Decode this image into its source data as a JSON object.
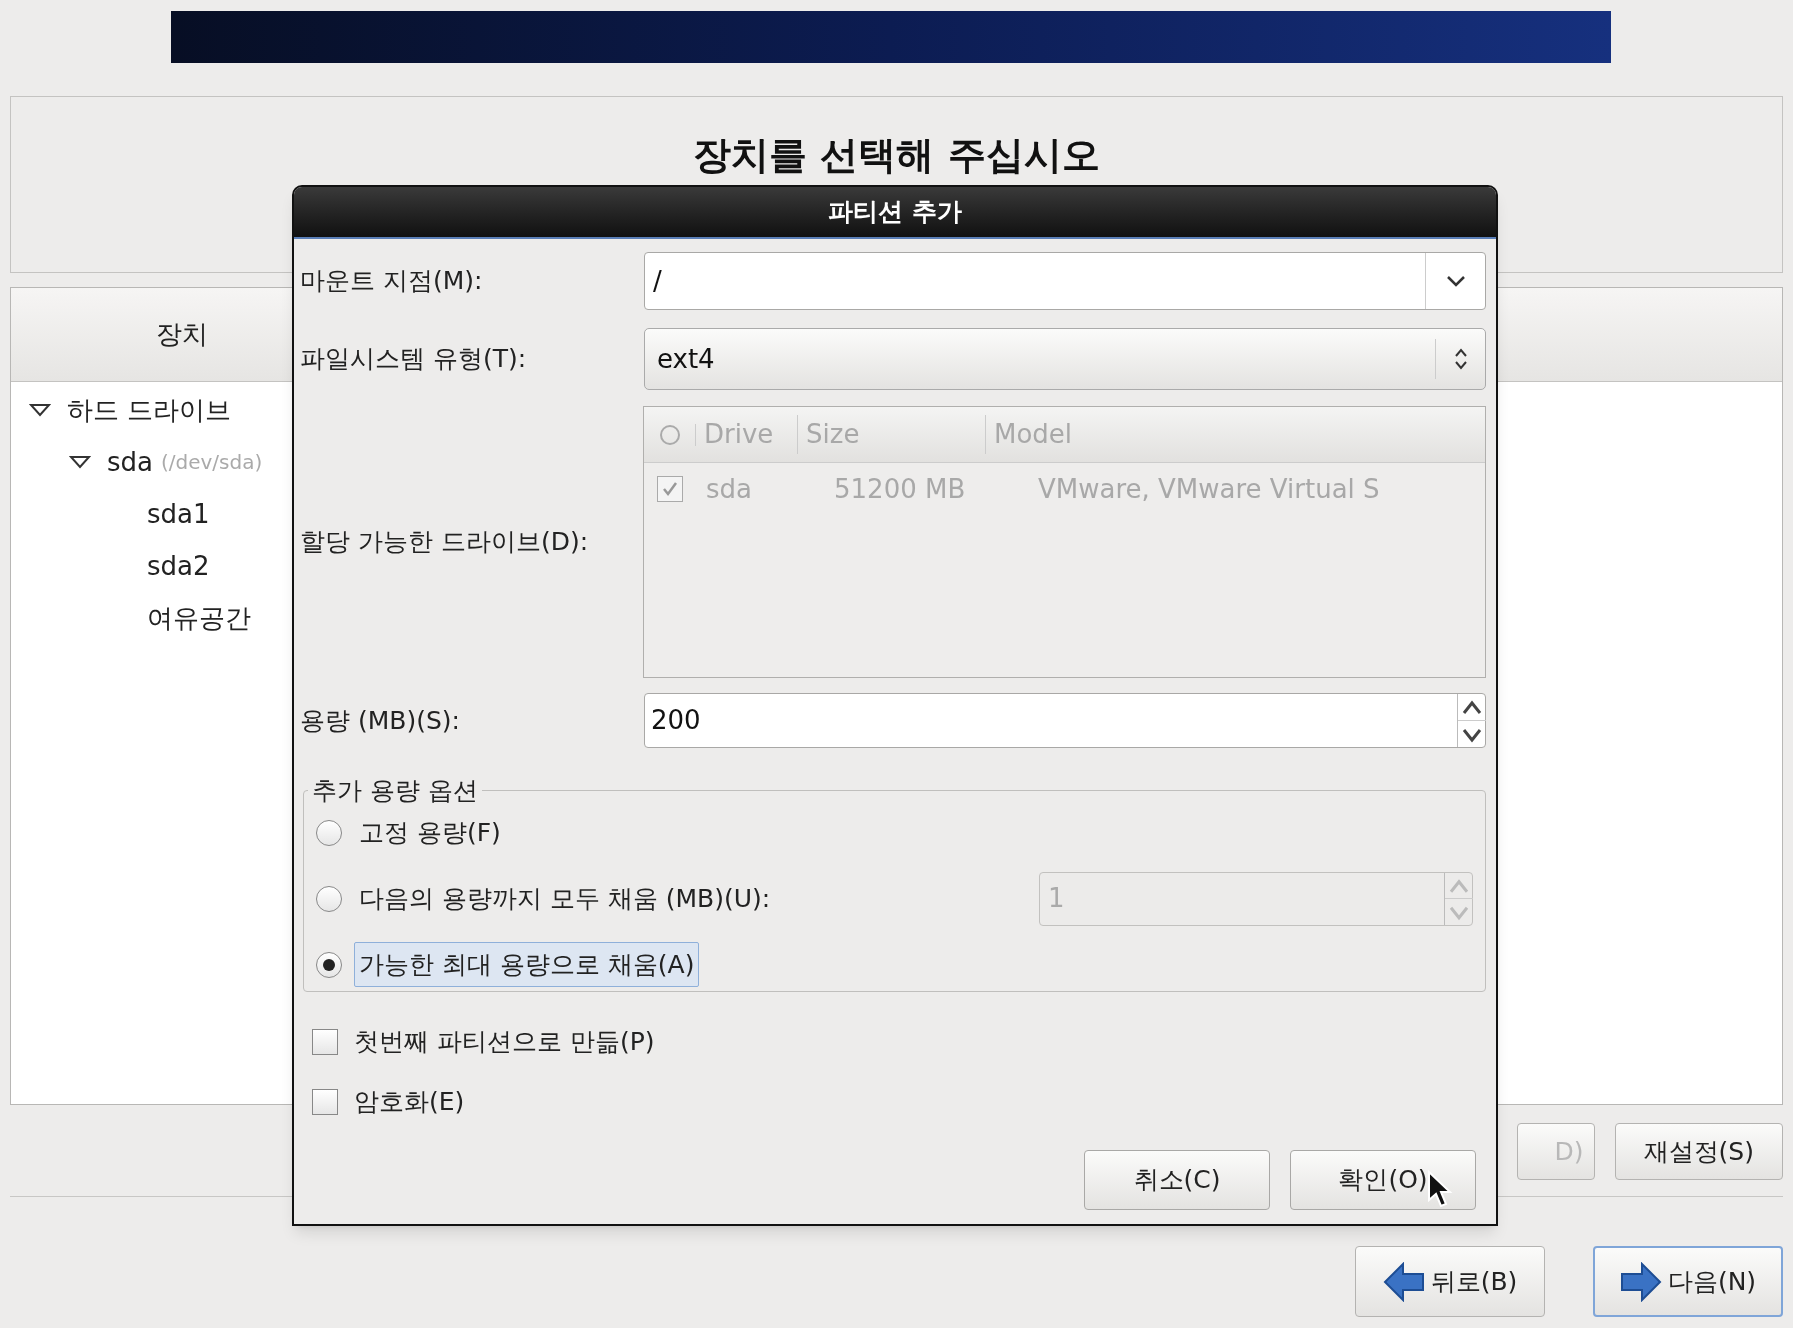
{
  "heading": "장치를 선택해 주십시오",
  "device_panel": {
    "column_header": "장치",
    "tree": [
      {
        "label": "하드 드라이브",
        "expanded": true,
        "children": [
          {
            "label": "sda",
            "path": "(/dev/sda)",
            "expanded": true,
            "children": [
              {
                "label": "sda1"
              },
              {
                "label": "sda2"
              },
              {
                "label": "여유공간"
              }
            ]
          }
        ]
      }
    ]
  },
  "panel_buttons": [
    {
      "label": "D)",
      "disabled": true
    },
    {
      "label": "재설정(S)",
      "disabled": false
    }
  ],
  "nav_buttons": [
    {
      "label": "뒤로(B)",
      "kind": "back",
      "focused": false
    },
    {
      "label": "다음(N)",
      "kind": "next",
      "focused": true
    }
  ],
  "dialog": {
    "title": "파티션 추가",
    "mount_point": {
      "label": "마운트 지점(M):",
      "value": "/"
    },
    "filesystem_type": {
      "label": "파일시스템 유형(T):",
      "value": "ext4"
    },
    "drives": {
      "label": "할당 가능한 드라이브(D):",
      "disabled": true,
      "columns": [
        "Drive",
        "Size",
        "Model"
      ],
      "rows": [
        {
          "checked": true,
          "drive": "sda",
          "size": "51200 MB",
          "model": "VMware, VMware Virtual S"
        }
      ]
    },
    "size": {
      "label": "용량 (MB)(S):",
      "value": "200"
    },
    "size_options": {
      "title": "추가 용량 옵션",
      "options": [
        {
          "label": "고정 용량(F)",
          "selected": false,
          "kind": "plain"
        },
        {
          "label": "다음의 용량까지 모두 채움 (MB)(U):",
          "selected": false,
          "kind": "spin",
          "value": "1"
        },
        {
          "label": "가능한 최대 용량으로 채움(A)",
          "selected": true,
          "kind": "plain"
        }
      ]
    },
    "checkboxes": [
      {
        "label": "첫번째 파티션으로 만듦(P)",
        "checked": false
      },
      {
        "label": "암호화(E)",
        "checked": false
      }
    ],
    "buttons": [
      "취소(C)",
      "확인(O)"
    ]
  }
}
